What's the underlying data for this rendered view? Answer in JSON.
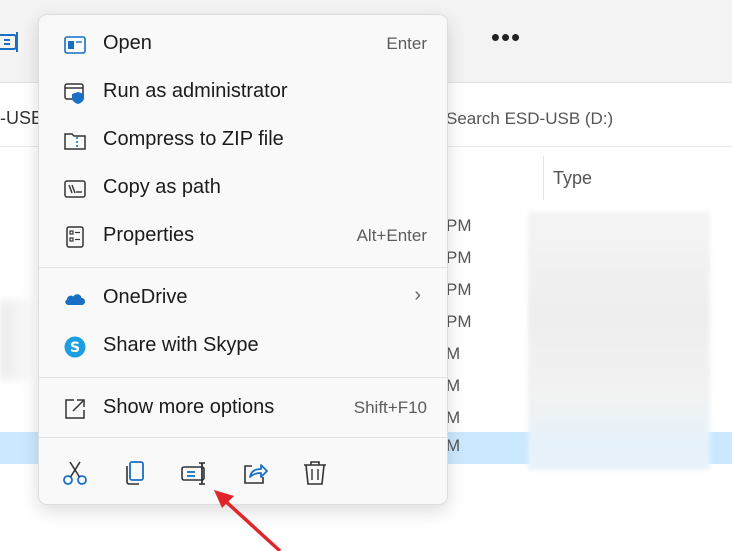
{
  "explorer": {
    "address_fragment": "-USB",
    "search_placeholder": "Search ESD-USB (D:)",
    "column_type": "Type",
    "more_label": "•••",
    "rows": [
      {
        "time": "PM",
        "selected": false
      },
      {
        "time": "PM",
        "selected": false
      },
      {
        "time": "PM",
        "selected": false
      },
      {
        "time": "PM",
        "selected": false
      },
      {
        "time": "M",
        "selected": false
      },
      {
        "time": "M",
        "selected": false
      },
      {
        "time": "M",
        "selected": false
      },
      {
        "time": "M",
        "selected": true
      }
    ]
  },
  "context_menu": {
    "items": [
      {
        "label": "Open",
        "shortcut": "Enter",
        "icon": "open-app-icon"
      },
      {
        "label": "Run as administrator",
        "shortcut": "",
        "icon": "admin-shield-icon"
      },
      {
        "label": "Compress to ZIP file",
        "shortcut": "",
        "icon": "zip-folder-icon"
      },
      {
        "label": "Copy as path",
        "shortcut": "",
        "icon": "copy-path-icon"
      },
      {
        "label": "Properties",
        "shortcut": "Alt+Enter",
        "icon": "properties-icon"
      },
      {
        "label": "OneDrive",
        "shortcut": "",
        "icon": "onedrive-cloud-icon"
      },
      {
        "label": "Share with Skype",
        "shortcut": "",
        "icon": "skype-icon"
      },
      {
        "label": "Show more options",
        "shortcut": "Shift+F10",
        "icon": "show-more-options-icon"
      }
    ],
    "chevron": "›",
    "actions": [
      {
        "name": "cut",
        "icon": "scissors-icon"
      },
      {
        "name": "copy",
        "icon": "copy-icon"
      },
      {
        "name": "rename",
        "icon": "rename-icon"
      },
      {
        "name": "share",
        "icon": "share-icon"
      },
      {
        "name": "delete",
        "icon": "trash-icon"
      }
    ]
  },
  "colors": {
    "accent": "#1a6fc4",
    "selection": "#cce8ff",
    "menu_bg": "#f9f9f9",
    "arrow": "#e0262b"
  }
}
